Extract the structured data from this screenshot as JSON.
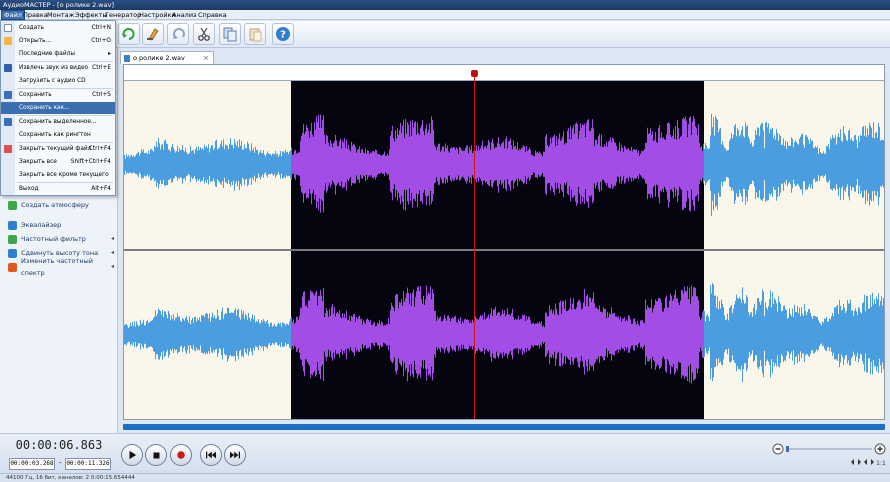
{
  "app": {
    "title": "АудиоМАСТЕР - [о ролике 2.wav]"
  },
  "menubar": [
    {
      "label": "Файл",
      "active": true
    },
    {
      "label": "Правка"
    },
    {
      "label": "Монтаж"
    },
    {
      "label": "Эффекты"
    },
    {
      "label": "Генератор"
    },
    {
      "label": "Настройки"
    },
    {
      "label": "Анализ"
    },
    {
      "label": "Справка"
    }
  ],
  "file_menu": [
    {
      "label": "Создать",
      "shortcut": "Ctrl+N",
      "icon": "new-file-icon"
    },
    {
      "label": "Открыть...",
      "shortcut": "Ctrl+O",
      "icon": "folder-open-icon"
    },
    {
      "label": "Последние файлы",
      "shortcut": "▸"
    },
    {
      "label": "Извлечь звук из видео",
      "shortcut": "Ctrl+E",
      "icon": "video-extract-icon"
    },
    {
      "label": "Загрузить с аудио CD",
      "shortcut": ""
    },
    {
      "label": "Сохранить",
      "shortcut": "Ctrl+S",
      "icon": "save-icon"
    },
    {
      "label": "Сохранить как...",
      "shortcut": "",
      "highlighted": true
    },
    {
      "label": "Сохранить выделенное...",
      "shortcut": "",
      "icon": "save-selection-icon"
    },
    {
      "label": "Сохранить как рингтон",
      "shortcut": ""
    },
    {
      "label": "Закрыть текущий файл",
      "shortcut": "Ctrl+F4",
      "icon": "close-file-icon"
    },
    {
      "label": "Закрыть все",
      "shortcut": "Shift+Ctrl+F4"
    },
    {
      "label": "Закрыть все кроме текущего",
      "shortcut": ""
    },
    {
      "label": "Выход",
      "shortcut": "Alt+F4"
    }
  ],
  "effects": [
    {
      "label": "Создать атмосферу",
      "color": "#3aa84a",
      "submenu": false
    },
    {
      "label": "Эквалайзер",
      "color": "#2f7fd0",
      "submenu": false
    },
    {
      "label": "Частотный фильтр",
      "color": "#3aa84a",
      "submenu": true
    },
    {
      "label": "Сдвинуть высоту тона",
      "color": "#2f7fd0",
      "submenu": true
    },
    {
      "label": "Изменить частотный спектр",
      "color": "#e05a1e",
      "submenu": true
    }
  ],
  "tab": {
    "label": "о ролике 2.wav"
  },
  "transport": {
    "current_time": "00:00:06.863",
    "sel_start": "00:00:03.268",
    "sel_end": "00:00:11.326"
  },
  "status": "44100 Гц, 16 бит, каналов: 2   0:00:15.654444",
  "colors": {
    "wave_normal": "#4a9ee0",
    "wave_selected": "#a24ee6",
    "selection_bg": "#05050f",
    "cursor": "#d21414"
  }
}
